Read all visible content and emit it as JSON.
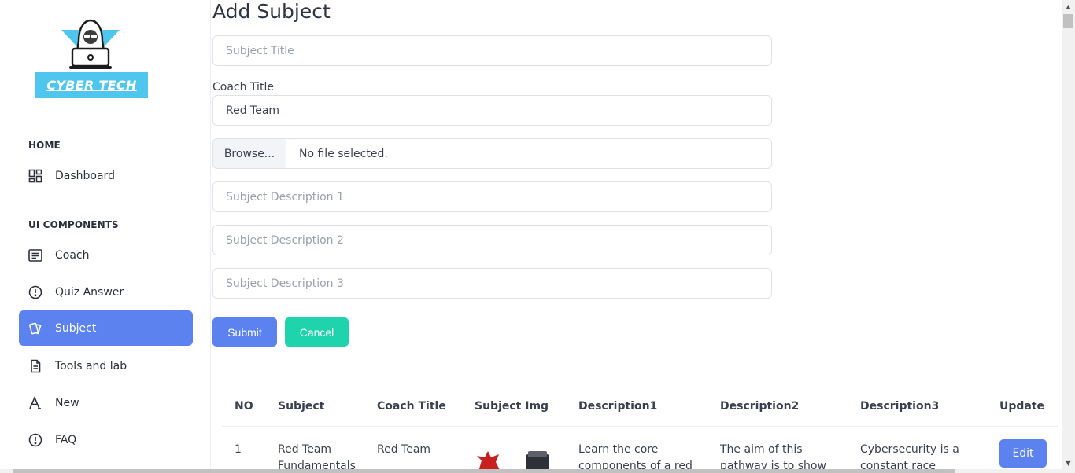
{
  "brand": {
    "name": "CYBER TECH"
  },
  "sidebar": {
    "section_home": "HOME",
    "section_ui": "UI COMPONENTS",
    "items": [
      {
        "label": "Dashboard",
        "icon": "dashboard-icon"
      },
      {
        "label": "Coach",
        "icon": "list-icon"
      },
      {
        "label": "Quiz Answer",
        "icon": "alert-circle-icon"
      },
      {
        "label": "Subject",
        "icon": "cards-icon",
        "active": true
      },
      {
        "label": "Tools and lab",
        "icon": "file-text-icon"
      },
      {
        "label": "New",
        "icon": "typography-icon"
      },
      {
        "label": "FAQ",
        "icon": "alert-circle-icon"
      }
    ]
  },
  "form": {
    "title": "Add Subject",
    "subject_title_placeholder": "Subject Title",
    "coach_label": "Coach Title",
    "coach_value": "Red Team",
    "browse_label": "Browse...",
    "file_status": "No file selected.",
    "desc1_placeholder": "Subject Description 1",
    "desc2_placeholder": "Subject Description 2",
    "desc3_placeholder": "Subject Description 3",
    "submit_label": "Submit",
    "cancel_label": "Cancel"
  },
  "table": {
    "headers": [
      "NO",
      "Subject",
      "Coach Title",
      "Subject Img",
      "Description1",
      "Description2",
      "Description3",
      "Update"
    ],
    "rows": [
      {
        "no": "1",
        "subject": "Red Team Fundamentals",
        "coach": "Red Team",
        "desc1": "Learn the core components of a red",
        "desc2": "The aim of this pathway is to show",
        "desc3": "Cybersecurity is a constant race",
        "action": "Edit"
      }
    ]
  },
  "colors": {
    "accent": "#5b82ef",
    "success": "#1fd3ad",
    "brand_banner": "#4fc6ee"
  }
}
